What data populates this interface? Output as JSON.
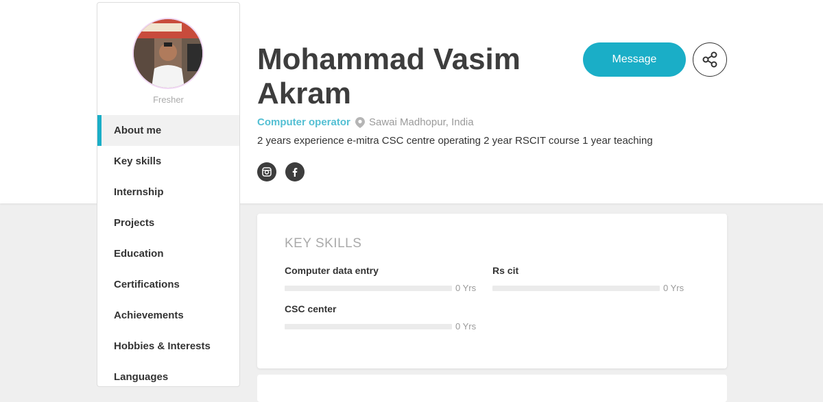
{
  "profile": {
    "status": "Fresher",
    "name": "Mohammad Vasim Akram",
    "role": "Computer operator",
    "location": "Sawai Madhopur, India",
    "summary": "2 years experience e-mitra CSC centre operating 2 year RSCIT course 1 year teaching"
  },
  "actions": {
    "message_label": "Message",
    "share_icon": "share-icon"
  },
  "social": [
    "instagram-icon",
    "facebook-icon"
  ],
  "sidebar": {
    "items": [
      {
        "label": "About me"
      },
      {
        "label": "Key skills"
      },
      {
        "label": "Internship"
      },
      {
        "label": "Projects"
      },
      {
        "label": "Education"
      },
      {
        "label": "Certifications"
      },
      {
        "label": "Achievements"
      },
      {
        "label": "Hobbies & Interests"
      },
      {
        "label": "Languages"
      }
    ]
  },
  "key_skills": {
    "title": "KEY SKILLS",
    "skills": [
      {
        "name": "Computer data entry",
        "years": "0 Yrs",
        "level": 0
      },
      {
        "name": "Rs cit",
        "years": "0 Yrs",
        "level": 0
      },
      {
        "name": "CSC center",
        "years": "0 Yrs",
        "level": 0
      }
    ]
  },
  "colors": {
    "accent": "#1aaec7",
    "role": "#53bfd3",
    "text_dark": "#3d3d3d"
  }
}
